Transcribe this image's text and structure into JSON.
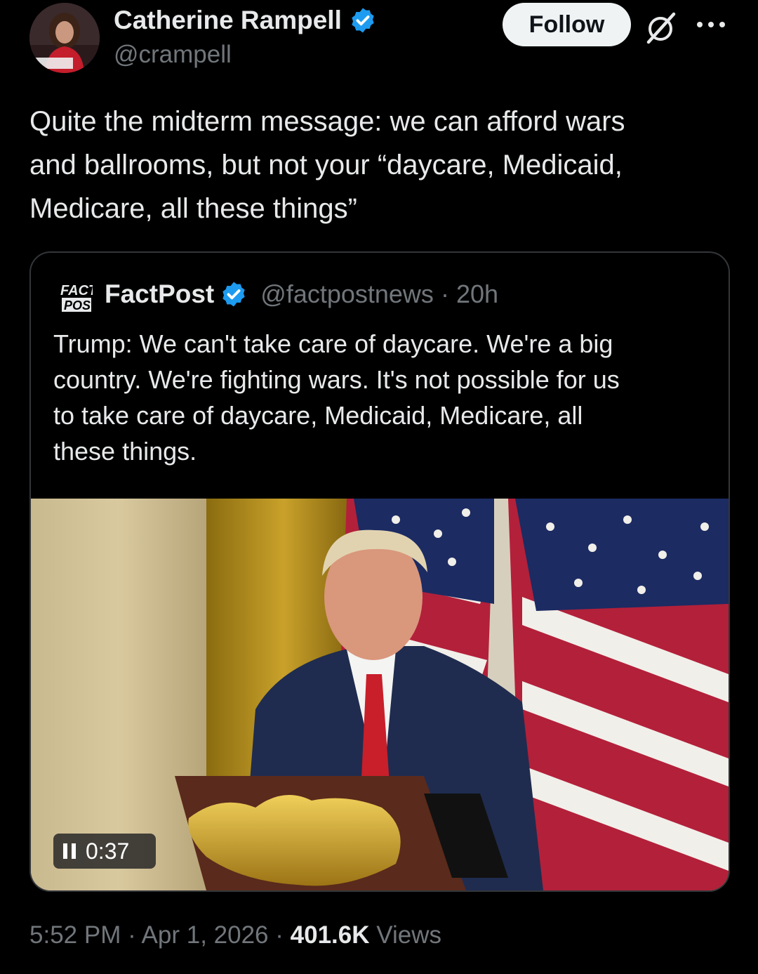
{
  "author": {
    "name": "Catherine Rampell",
    "handle": "@crampell",
    "avatar_caption": "CATHERINE RAMPELL"
  },
  "actions": {
    "follow_label": "Follow"
  },
  "tweet": {
    "text_lines": [
      "Quite the midterm message: we can afford wars",
      "and ballrooms, but not your “daycare, Medicaid,",
      "Medicare, all these things”"
    ]
  },
  "quote": {
    "logo_text_top": "FACT",
    "logo_text_bottom": "POST",
    "name": "FactPost",
    "handle": "@factpostnews",
    "separator": "·",
    "time": "20h",
    "text_lines": [
      "Trump: We can't take care of daycare. We're a big",
      "country. We're fighting wars. It's not possible for us",
      "to take care of daycare, Medicaid, Medicare, all",
      "these things."
    ],
    "video": {
      "duration": "0:37"
    }
  },
  "footer": {
    "time": "5:52 PM",
    "sep1": "·",
    "date": "Apr 1, 2026",
    "sep2": "·",
    "views_count": "401.6K",
    "views_label": "Views"
  },
  "colors": {
    "background": "#000000",
    "text": "#e7e9ea",
    "muted": "#71767b",
    "verified": "#1d9bf0",
    "border": "#333639"
  },
  "icons": {
    "verified": "verified-badge-icon",
    "grok": "grok-icon",
    "more": "more-horizontal-icon",
    "pause": "pause-icon"
  }
}
